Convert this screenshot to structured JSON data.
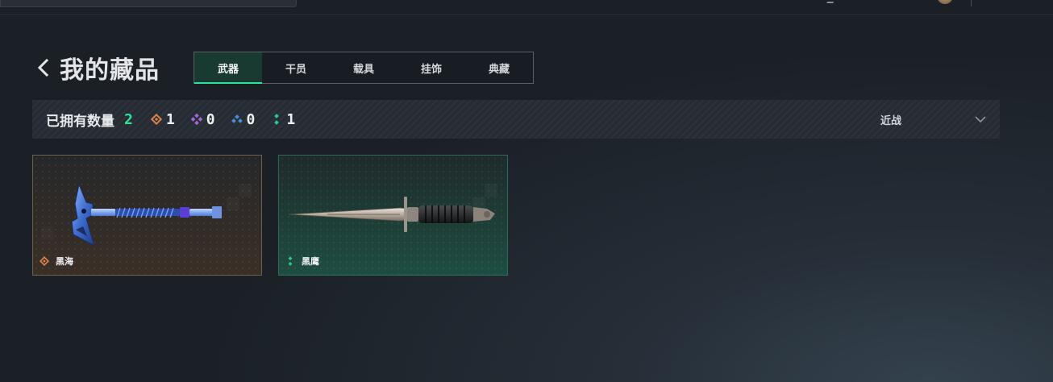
{
  "page": {
    "title": "我的藏品",
    "back_icon": "chevron-left-icon"
  },
  "tabs": [
    {
      "label": "武器",
      "active": true
    },
    {
      "label": "干员",
      "active": false
    },
    {
      "label": "载具",
      "active": false
    },
    {
      "label": "挂饰",
      "active": false
    },
    {
      "label": "典藏",
      "active": false
    }
  ],
  "summary": {
    "owned_label": "已拥有数量",
    "owned_count": "2",
    "rarities": [
      {
        "icon": "orange-diamond-icon",
        "color": "#d9824a",
        "count": "1"
      },
      {
        "icon": "purple-diamond-icon",
        "color": "#9a6ad8",
        "count": "0"
      },
      {
        "icon": "blue-triangle-icon",
        "color": "#4d8fd6",
        "count": "0"
      },
      {
        "icon": "green-dots-icon",
        "color": "#2ec98f",
        "count": "1"
      }
    ]
  },
  "sort": {
    "selected": "近战",
    "icon": "chevron-down-icon"
  },
  "items": [
    {
      "name": "黑海",
      "rarity_icon": "orange-diamond-icon",
      "rarity_color": "#d9824a",
      "weapon": "tomahawk"
    },
    {
      "name": "黑鹰",
      "rarity_icon": "green-dots-icon",
      "rarity_color": "#2ec98f",
      "weapon": "dagger"
    }
  ],
  "colors": {
    "accent": "#2ee39a",
    "active_tab_bg": "#183a30"
  }
}
